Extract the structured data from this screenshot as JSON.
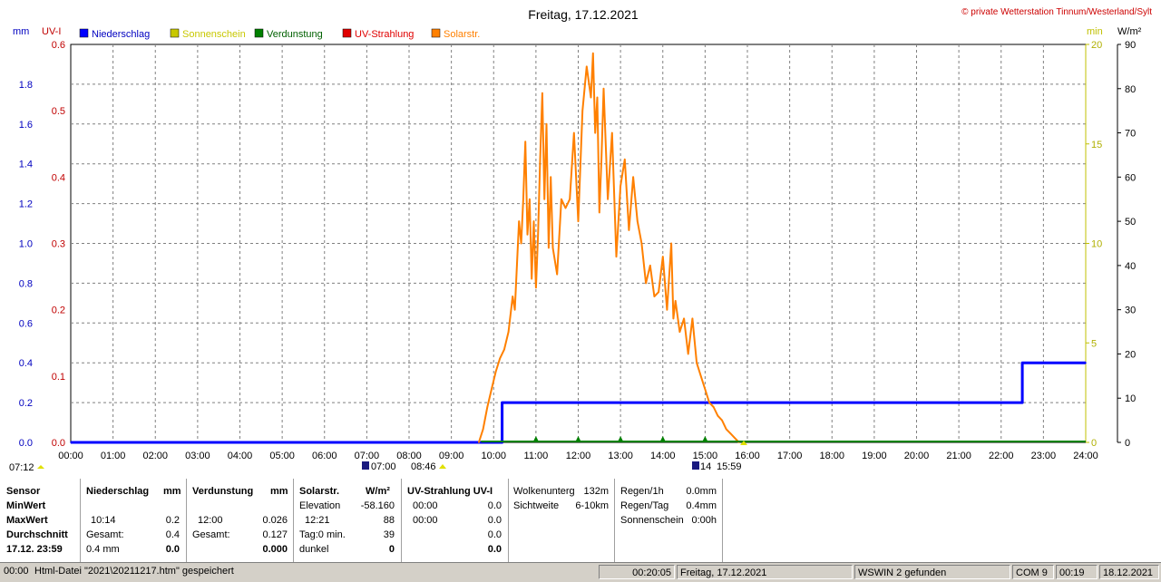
{
  "chart_data": {
    "type": "line",
    "title": "Freitag, 17.12.2021",
    "copyright": "© private Wetterstation Tinnum/Westerland/Sylt",
    "axis_labels": {
      "mm": "mm",
      "uvi": "UV-I",
      "min": "min",
      "wm2": "W/m²"
    },
    "x_ticks": [
      "00:00",
      "01:00",
      "02:00",
      "03:00",
      "04:00",
      "05:00",
      "06:00",
      "07:00",
      "08:00",
      "09:00",
      "10:00",
      "11:00",
      "12:00",
      "13:00",
      "14:00",
      "15:00",
      "16:00",
      "17:00",
      "18:00",
      "19:00",
      "20:00",
      "21:00",
      "22:00",
      "23:00",
      "24:00"
    ],
    "xlim": [
      0,
      24
    ],
    "axes": {
      "mm": {
        "ticks": [
          "0.0",
          "0.2",
          "0.4",
          "0.6",
          "0.8",
          "1.0",
          "1.2",
          "1.4",
          "1.6",
          "1.8"
        ],
        "ylim": [
          0,
          2.0
        ],
        "color": "#0000c0"
      },
      "uvi": {
        "ticks": [
          "0.0",
          "0.1",
          "0.2",
          "0.3",
          "0.4",
          "0.5",
          "0.6"
        ],
        "ylim": [
          0,
          0.6
        ],
        "color": "#c00000"
      },
      "min": {
        "ticks": [
          "0",
          "5",
          "10",
          "15",
          "20"
        ],
        "ylim": [
          0,
          20
        ],
        "color": "#c0c000"
      },
      "wm2": {
        "ticks": [
          "0",
          "10",
          "20",
          "30",
          "40",
          "50",
          "60",
          "70",
          "80",
          "90"
        ],
        "ylim": [
          0,
          90
        ],
        "color": "#000000"
      }
    },
    "legend": [
      {
        "name": "Niederschlag",
        "color": "#0000ff",
        "text_color": "#0000c0"
      },
      {
        "name": "Sonnenschein",
        "color": "#c8c800",
        "text_color": "#c8c800"
      },
      {
        "name": "Verdunstung",
        "color": "#008000",
        "text_color": "#006000"
      },
      {
        "name": "UV-Strahlung",
        "color": "#e00000",
        "text_color": "#e00000"
      },
      {
        "name": "Solarstr.",
        "color": "#ff8000",
        "text_color": "#ff8000"
      }
    ],
    "series": [
      {
        "name": "Niederschlag",
        "axis": "mm",
        "color": "#0000ff",
        "step": true,
        "x": [
          0,
          10.2,
          10.2,
          22.5,
          22.5,
          24
        ],
        "values": [
          0,
          0,
          0.2,
          0.2,
          0.4,
          0.4
        ]
      },
      {
        "name": "Solarstr.",
        "axis": "wm2",
        "color": "#ff8000",
        "x": [
          9.65,
          9.75,
          9.85,
          9.95,
          10.05,
          10.15,
          10.25,
          10.35,
          10.45,
          10.5,
          10.55,
          10.6,
          10.65,
          10.7,
          10.75,
          10.8,
          10.85,
          10.9,
          10.95,
          11.0,
          11.05,
          11.1,
          11.15,
          11.2,
          11.25,
          11.3,
          11.35,
          11.4,
          11.5,
          11.6,
          11.7,
          11.8,
          11.9,
          12.0,
          12.1,
          12.2,
          12.3,
          12.35,
          12.4,
          12.45,
          12.5,
          12.55,
          12.6,
          12.7,
          12.8,
          12.9,
          13.0,
          13.1,
          13.2,
          13.3,
          13.4,
          13.5,
          13.6,
          13.7,
          13.8,
          13.9,
          14.0,
          14.1,
          14.2,
          14.25,
          14.3,
          14.4,
          14.5,
          14.6,
          14.7,
          14.8,
          14.9,
          15.0,
          15.1,
          15.2,
          15.3,
          15.4,
          15.5,
          15.6,
          15.7,
          15.8
        ],
        "values": [
          0,
          3,
          8,
          12,
          16,
          19,
          21,
          25,
          33,
          30,
          40,
          50,
          45,
          55,
          68,
          47,
          55,
          37,
          50,
          35,
          47,
          64,
          79,
          55,
          72,
          44,
          60,
          44,
          38,
          55,
          53,
          55,
          70,
          50,
          75,
          85,
          78,
          88,
          70,
          78,
          52,
          64,
          80,
          55,
          70,
          42,
          58,
          64,
          48,
          60,
          50,
          45,
          36,
          40,
          33,
          34,
          42,
          30,
          45,
          28,
          32,
          25,
          28,
          20,
          28,
          18,
          15,
          12,
          9,
          8,
          6,
          5,
          3,
          2,
          1,
          0
        ]
      }
    ],
    "markers": {
      "sunrise": "07:00",
      "sunset": "15:59",
      "dawn": "07:12",
      "yellow": "08:46",
      "sunset_prefix": "14"
    }
  },
  "table": {
    "sensor": {
      "header": "Sensor",
      "rows": [
        "MinWert",
        "MaxWert",
        "Durchschnitt",
        "17.12. 23:59"
      ]
    },
    "niederschlag": {
      "header": "Niederschlag",
      "unit": "mm",
      "max_time": "10:14",
      "max_value": "0.2",
      "gesamt_label": "Gesamt:",
      "gesamt_value": "0.4",
      "avg_label": "0.4 mm",
      "avg_value": "0.0"
    },
    "verdunstung": {
      "header": "Verdunstung",
      "unit": "mm",
      "max_time": "12:00",
      "max_value": "0.026",
      "gesamt_label": "Gesamt:",
      "gesamt_value": "0.127",
      "current": "0.000"
    },
    "solar": {
      "header": "Solarstr.",
      "unit": "W/m²",
      "elevation_label": "Elevation",
      "elevation_value": "-58.160",
      "max_time": "12:21",
      "max_value": "88",
      "tag_label": "Tag:0 min.",
      "tag_value": "39",
      "dunkel_label": "dunkel",
      "dunkel_value": "0"
    },
    "uv": {
      "header": "UV-Strahlung UV-I",
      "min_time": "00:00",
      "min_value": "0.0",
      "max_time": "00:00",
      "max_value": "0.0",
      "avg_value": "0.0",
      "current": "0.0"
    },
    "wolken": {
      "label1": "Wolkenunterg",
      "value1": "132m",
      "label2": "Sichtweite",
      "value2": "6-10km"
    },
    "regen": {
      "label1": "Regen/1h",
      "value1": "0.0mm",
      "label2": "Regen/Tag",
      "value2": "0.4mm",
      "label3": "Sonnenschein",
      "value3": "0:00h"
    }
  },
  "statusbar": {
    "left_time": "00:00",
    "message": "Html-Datei  \"2021\\20211217.htm\"  gespeichert",
    "elapsed": "00:20:05",
    "date": "Freitag, 17.12.2021",
    "wswin": "WSWIN 2 gefunden",
    "com": "COM 9",
    "time": "00:19",
    "today": "18.12.2021"
  }
}
